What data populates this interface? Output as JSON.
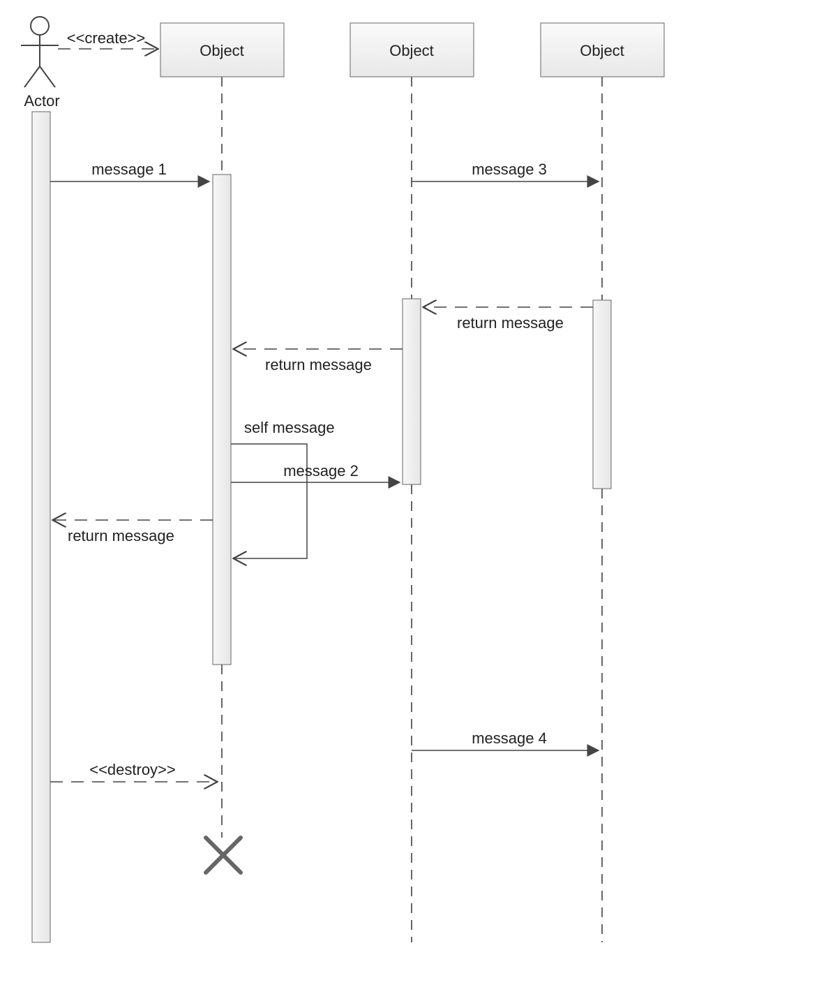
{
  "participants": {
    "actor": "Actor",
    "object1": "Object",
    "object2": "Object",
    "object3": "Object"
  },
  "messages": {
    "create": "<<create>>",
    "msg1": "message 1",
    "msg2": "message 2",
    "msg3": "message 3",
    "msg4": "message 4",
    "return_obj3_obj2": "return message",
    "return_obj2_obj1": "return message",
    "return_obj1_actor": "return message",
    "self": "self message",
    "destroy": "<<destroy>>"
  }
}
